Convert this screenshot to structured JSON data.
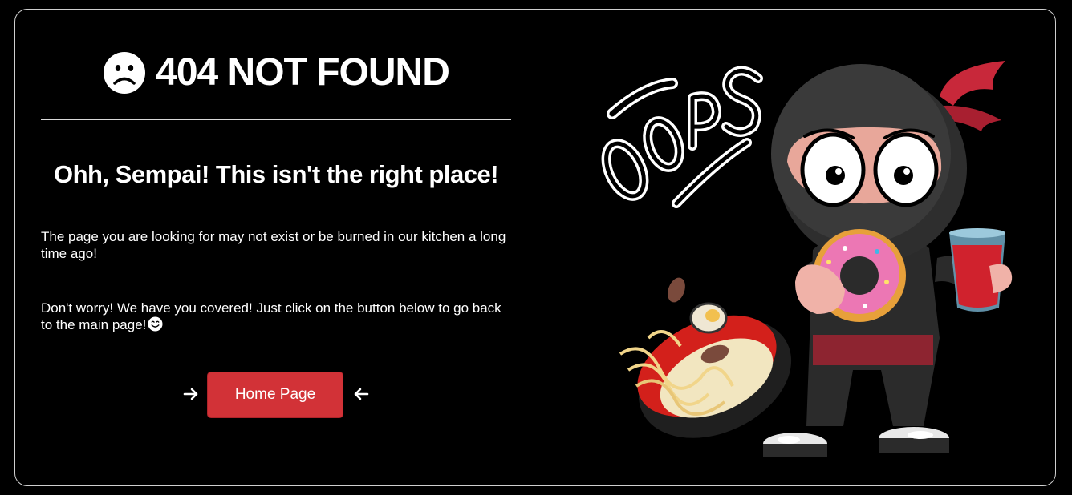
{
  "header": {
    "title": "404 NOT FOUND",
    "icon": "sad-face-icon"
  },
  "main": {
    "subtitle": "Ohh, Sempai! This isn't the right place!",
    "paragraph1": "The page you are looking for may not exist or be burned in our kitchen a long time ago!",
    "paragraph2": "Don't worry! We have you covered! Just click on the button below to go back to the main page!",
    "paragraph2_emoji": "smile-emoji-icon"
  },
  "actions": {
    "home_label": "Home Page",
    "left_arrow": "arrow-right-icon",
    "right_arrow": "arrow-left-icon"
  },
  "illustration": {
    "oops_text": "OOPS",
    "subject": "ninja-with-donut-and-ramen-illustration"
  },
  "colors": {
    "background": "#000000",
    "button": "#d23237",
    "text": "#ffffff",
    "border": "#cfcfcf"
  }
}
